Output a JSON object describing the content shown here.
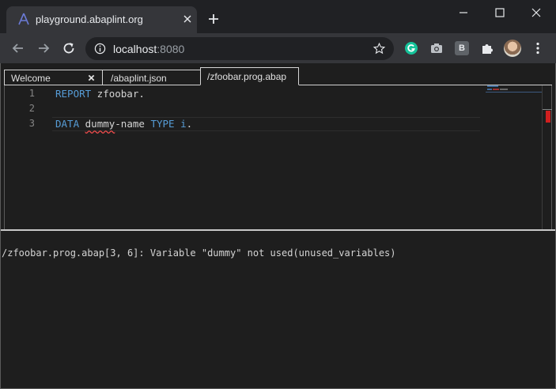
{
  "browser": {
    "tab_title": "playground.abaplint.org",
    "url_host": "localhost",
    "url_port": ":8080",
    "extension_b_label": "B"
  },
  "editor_tabs": [
    {
      "label": "Welcome",
      "closable": true
    },
    {
      "label": "/abaplint.json"
    },
    {
      "label": "/zfoobar.prog.abap",
      "active": true
    }
  ],
  "editor": {
    "line_numbers": [
      "1",
      "2",
      "3"
    ],
    "line1": {
      "kw": "REPORT",
      "rest": " zfoobar."
    },
    "line3": {
      "kw1": "DATA",
      "sp1": " ",
      "err": "dummy",
      "mid": "-name ",
      "kw2": "TYPE",
      "sp2": " ",
      "type": "i",
      "end": "."
    }
  },
  "problems": [
    "/zfoobar.prog.abap[3, 6]: Variable \"dummy\" not used(unused_variables)"
  ],
  "colors": {
    "keyword": "#569cd6",
    "error_marker": "#d11f1f",
    "chrome_dark": "#202124",
    "chrome_toolbar": "#35363a"
  },
  "icons": [
    "abaplint-logo-icon",
    "close-icon",
    "plus-icon",
    "minimize-icon",
    "maximize-icon",
    "back-arrow-icon",
    "forward-arrow-icon",
    "reload-icon",
    "info-icon",
    "star-icon",
    "grammarly-icon",
    "camera-icon",
    "puzzle-icon",
    "avatar",
    "kebab-menu-icon"
  ]
}
